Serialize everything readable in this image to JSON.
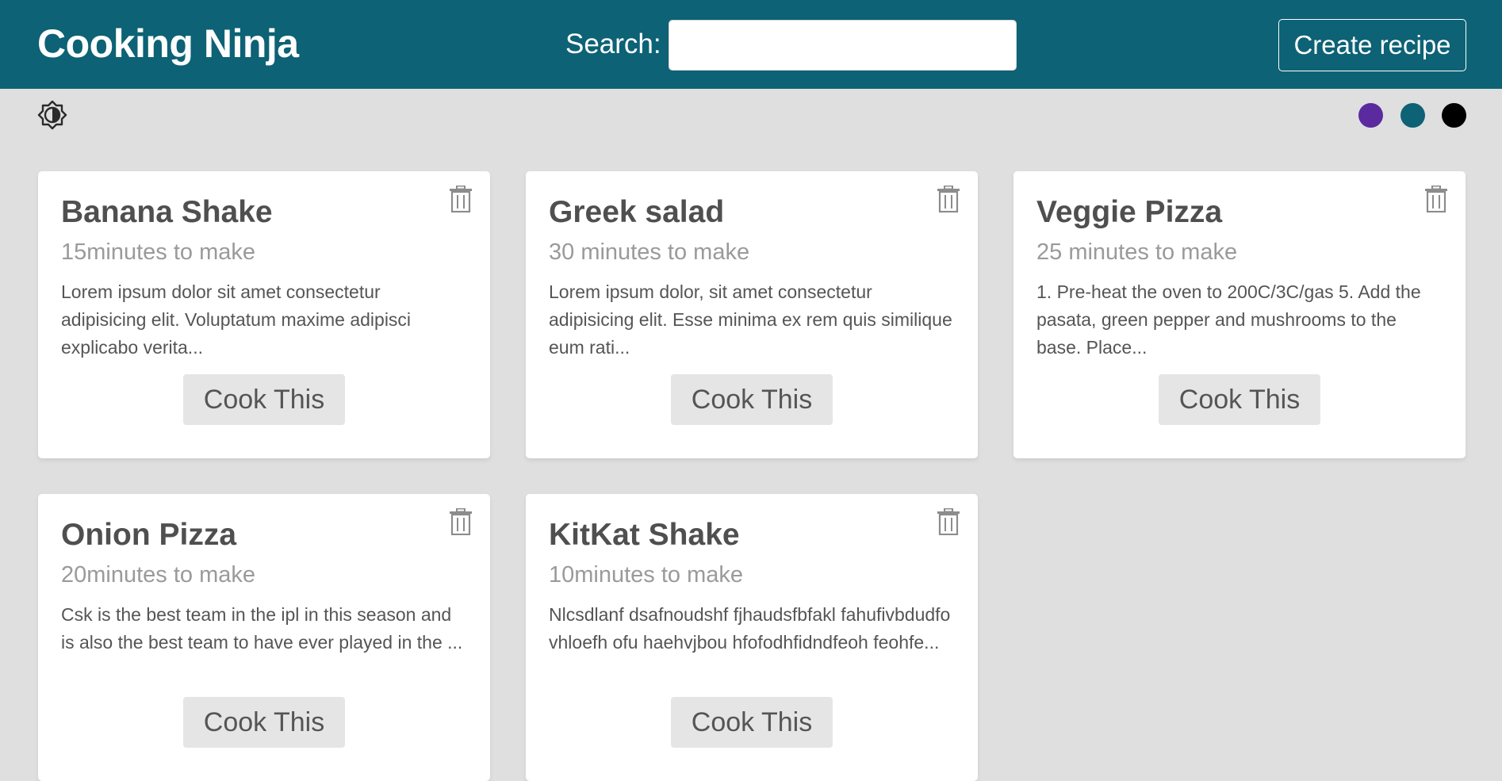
{
  "header": {
    "brand": "Cooking Ninja",
    "search_label": "Search:",
    "search_value": "",
    "create_label": "Create recipe"
  },
  "toolbar": {
    "mode_icon": "brightness-toggle-icon",
    "theme_colors": [
      "#5b2a9f",
      "#0d6275",
      "#000000"
    ]
  },
  "recipes": [
    {
      "title": "Banana Shake",
      "time": "15minutes to make",
      "description": "Lorem ipsum dolor sit amet consectetur adipisicing elit. Voluptatum maxime adipisci explicabo verita...",
      "button_label": "Cook This",
      "delete_icon": "trash-icon"
    },
    {
      "title": "Greek salad",
      "time": "30 minutes to make",
      "description": "Lorem ipsum dolor, sit amet consectetur adipisicing elit. Esse minima ex rem quis similique eum rati...",
      "button_label": "Cook This",
      "delete_icon": "trash-icon"
    },
    {
      "title": "Veggie Pizza",
      "time": "25 minutes to make",
      "description": "1. Pre-heat the oven to 200C/3C/gas 5. Add the pasata, green pepper and mushrooms to the base. Place...",
      "button_label": "Cook This",
      "delete_icon": "trash-icon"
    },
    {
      "title": "Onion Pizza",
      "time": "20minutes to make",
      "description": "Csk is the best team in the ipl in this season and is also the best team to have ever played in the ...",
      "button_label": "Cook This",
      "delete_icon": "trash-icon"
    },
    {
      "title": "KitKat Shake",
      "time": "10minutes to make",
      "description": "Nlcsdlanf dsafnoudshf fjhaudsfbfakl fahufivbdudfo vhloefh ofu haehvjbou hfofodhfidndfeoh feohfe...",
      "button_label": "Cook This",
      "delete_icon": "trash-icon"
    }
  ]
}
